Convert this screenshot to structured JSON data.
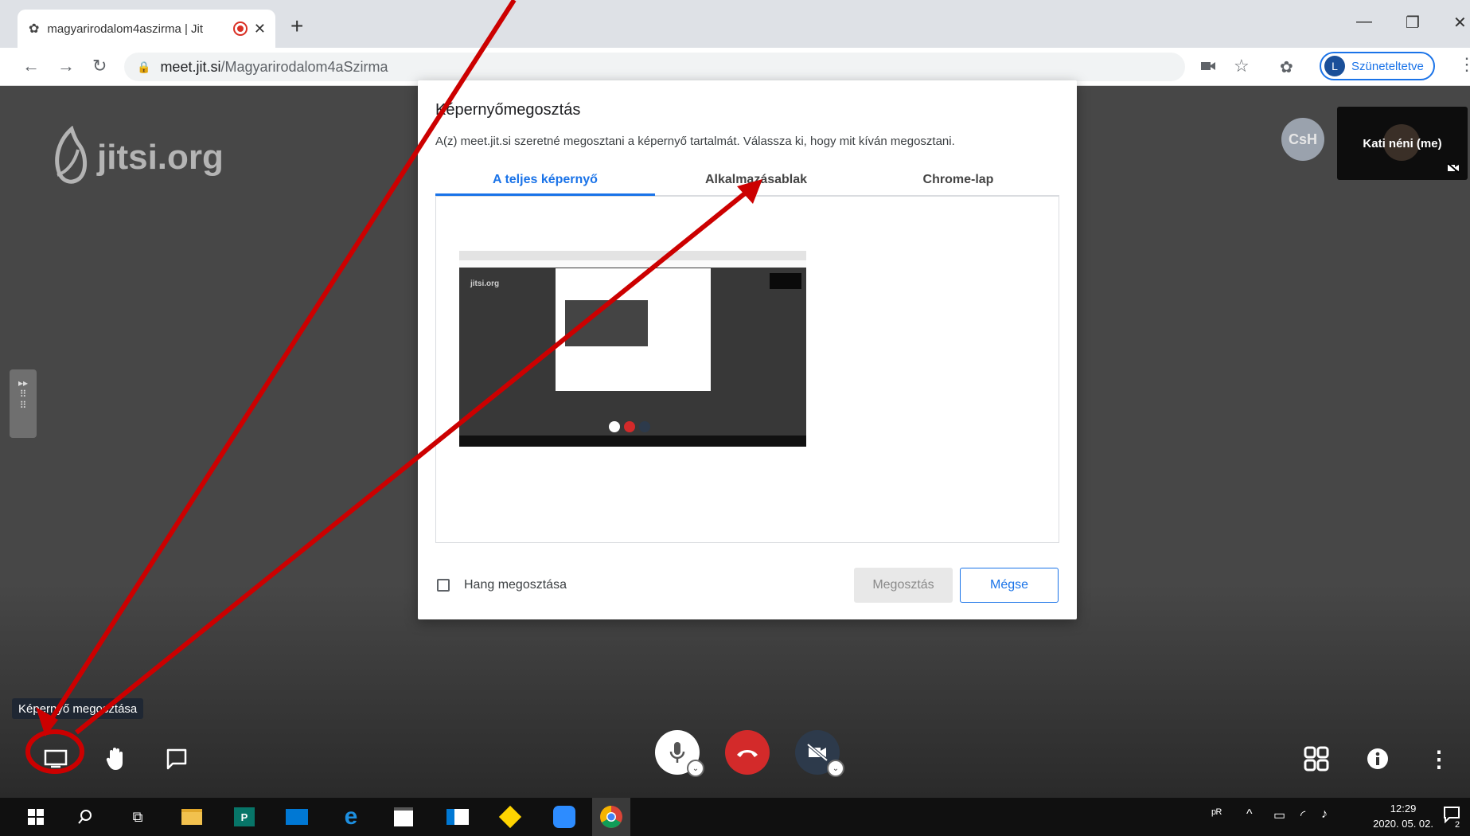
{
  "browser": {
    "tab_title": "magyarirodalom4aszirma | Jit",
    "new_tab": "+",
    "url_host": "meet.jit.si",
    "url_path": "/Magyarirodalom4aSzirma",
    "profile_initial": "L",
    "profile_label": "Szüneteltetve"
  },
  "jitsi": {
    "logo_text": "jitsi.org",
    "remote_avatar_initials": "CsH",
    "local_name": "Kati néni (me)",
    "tooltip": "Képernyő megosztása"
  },
  "share_dialog": {
    "title": "Képernyőmegosztás",
    "description": "A(z) meet.jit.si szeretné megosztani a képernyő tartalmát. Válassza ki, hogy mit kíván megosztani.",
    "tabs": [
      {
        "label": "A teljes képernyő",
        "active": true
      },
      {
        "label": "Alkalmazásablak",
        "active": false
      },
      {
        "label": "Chrome-lap",
        "active": false
      }
    ],
    "audio_share_label": "Hang megosztása",
    "share_button": "Megosztás",
    "cancel_button": "Mégse"
  },
  "taskbar": {
    "time": "12:29",
    "date": "2020. 05. 02.",
    "notification_count": "2"
  },
  "colors": {
    "accent": "#1a73e8",
    "hangup": "#d32a2a",
    "annotation_red": "#cc0000",
    "stage_bg": "#474747"
  },
  "icons": [
    "screenshare-icon",
    "raise-hand-icon",
    "chat-icon",
    "microphone-icon",
    "hangup-icon",
    "camera-off-icon",
    "tile-view-icon",
    "info-icon",
    "more-icon"
  ]
}
